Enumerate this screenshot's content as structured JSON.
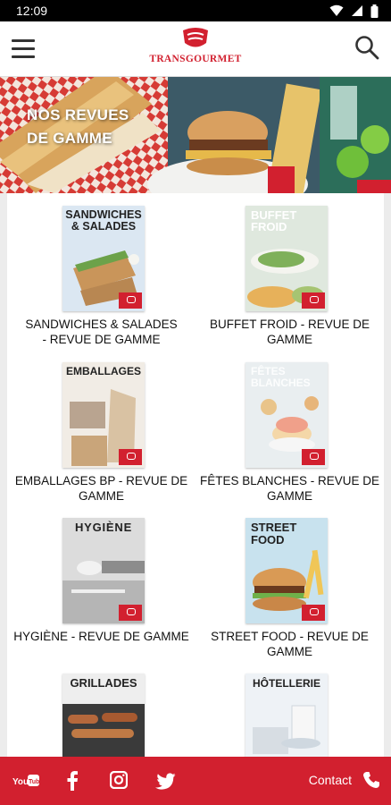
{
  "status": {
    "time": "12:09"
  },
  "brand": {
    "name": "TRANSGOURMET",
    "color": "#d2202f"
  },
  "banner": {
    "line1": "NOS REVUES",
    "line2": "DE GAMME"
  },
  "catalogs": [
    {
      "cover_title": "SANDWICHES\n& SALADES",
      "label": "SANDWICHES & SALADES - REVUE DE GAMME"
    },
    {
      "cover_title": "BUFFET\nFROID",
      "label": "BUFFET FROID - REVUE DE GAMME"
    },
    {
      "cover_title": "EMBALLAGES",
      "label": "EMBALLAGES BP - REVUE DE GAMME"
    },
    {
      "cover_title": "FÊTES\nBLANCHES",
      "label": "FÊTES BLANCHES - REVUE DE GAMME"
    },
    {
      "cover_title": "HYGIÈNE",
      "label": "HYGIÈNE - REVUE DE GAMME"
    },
    {
      "cover_title": "STREET\nFOOD",
      "label": "STREET FOOD - REVUE DE GAMME"
    },
    {
      "cover_title": "GRILLADES",
      "label": ""
    },
    {
      "cover_title": "HÔTELLERIE",
      "label": ""
    }
  ],
  "footer": {
    "contact_label": "Contact",
    "youtube_label": "You Tube"
  },
  "icons": [
    "menu-icon",
    "search-icon",
    "youtube-icon",
    "facebook-icon",
    "instagram-icon",
    "twitter-icon",
    "phone-icon",
    "wifi-icon",
    "signal-icon",
    "battery-icon"
  ]
}
